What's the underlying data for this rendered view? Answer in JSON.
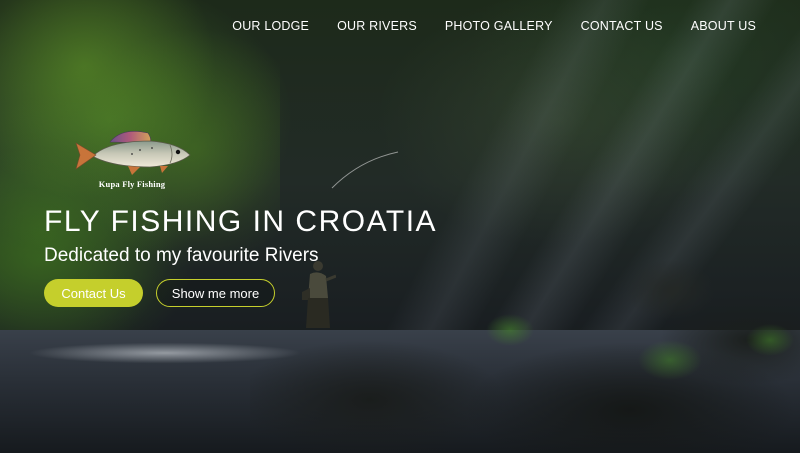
{
  "nav": {
    "items": [
      {
        "label": "OUR LODGE"
      },
      {
        "label": "OUR RIVERS"
      },
      {
        "label": "PHOTO GALLERY"
      },
      {
        "label": "CONTACT US"
      },
      {
        "label": "ABOUT US"
      }
    ]
  },
  "logo": {
    "text": "Kupa Fly Fishing",
    "icon": "grayling-fish-icon"
  },
  "hero": {
    "headline": "FLY FISHING IN CROATIA",
    "subheadline": "Dedicated to my favourite Rivers",
    "primary_button": "Contact Us",
    "secondary_button": "Show me more"
  },
  "colors": {
    "accent": "#c5cf2c",
    "text": "#ffffff"
  }
}
